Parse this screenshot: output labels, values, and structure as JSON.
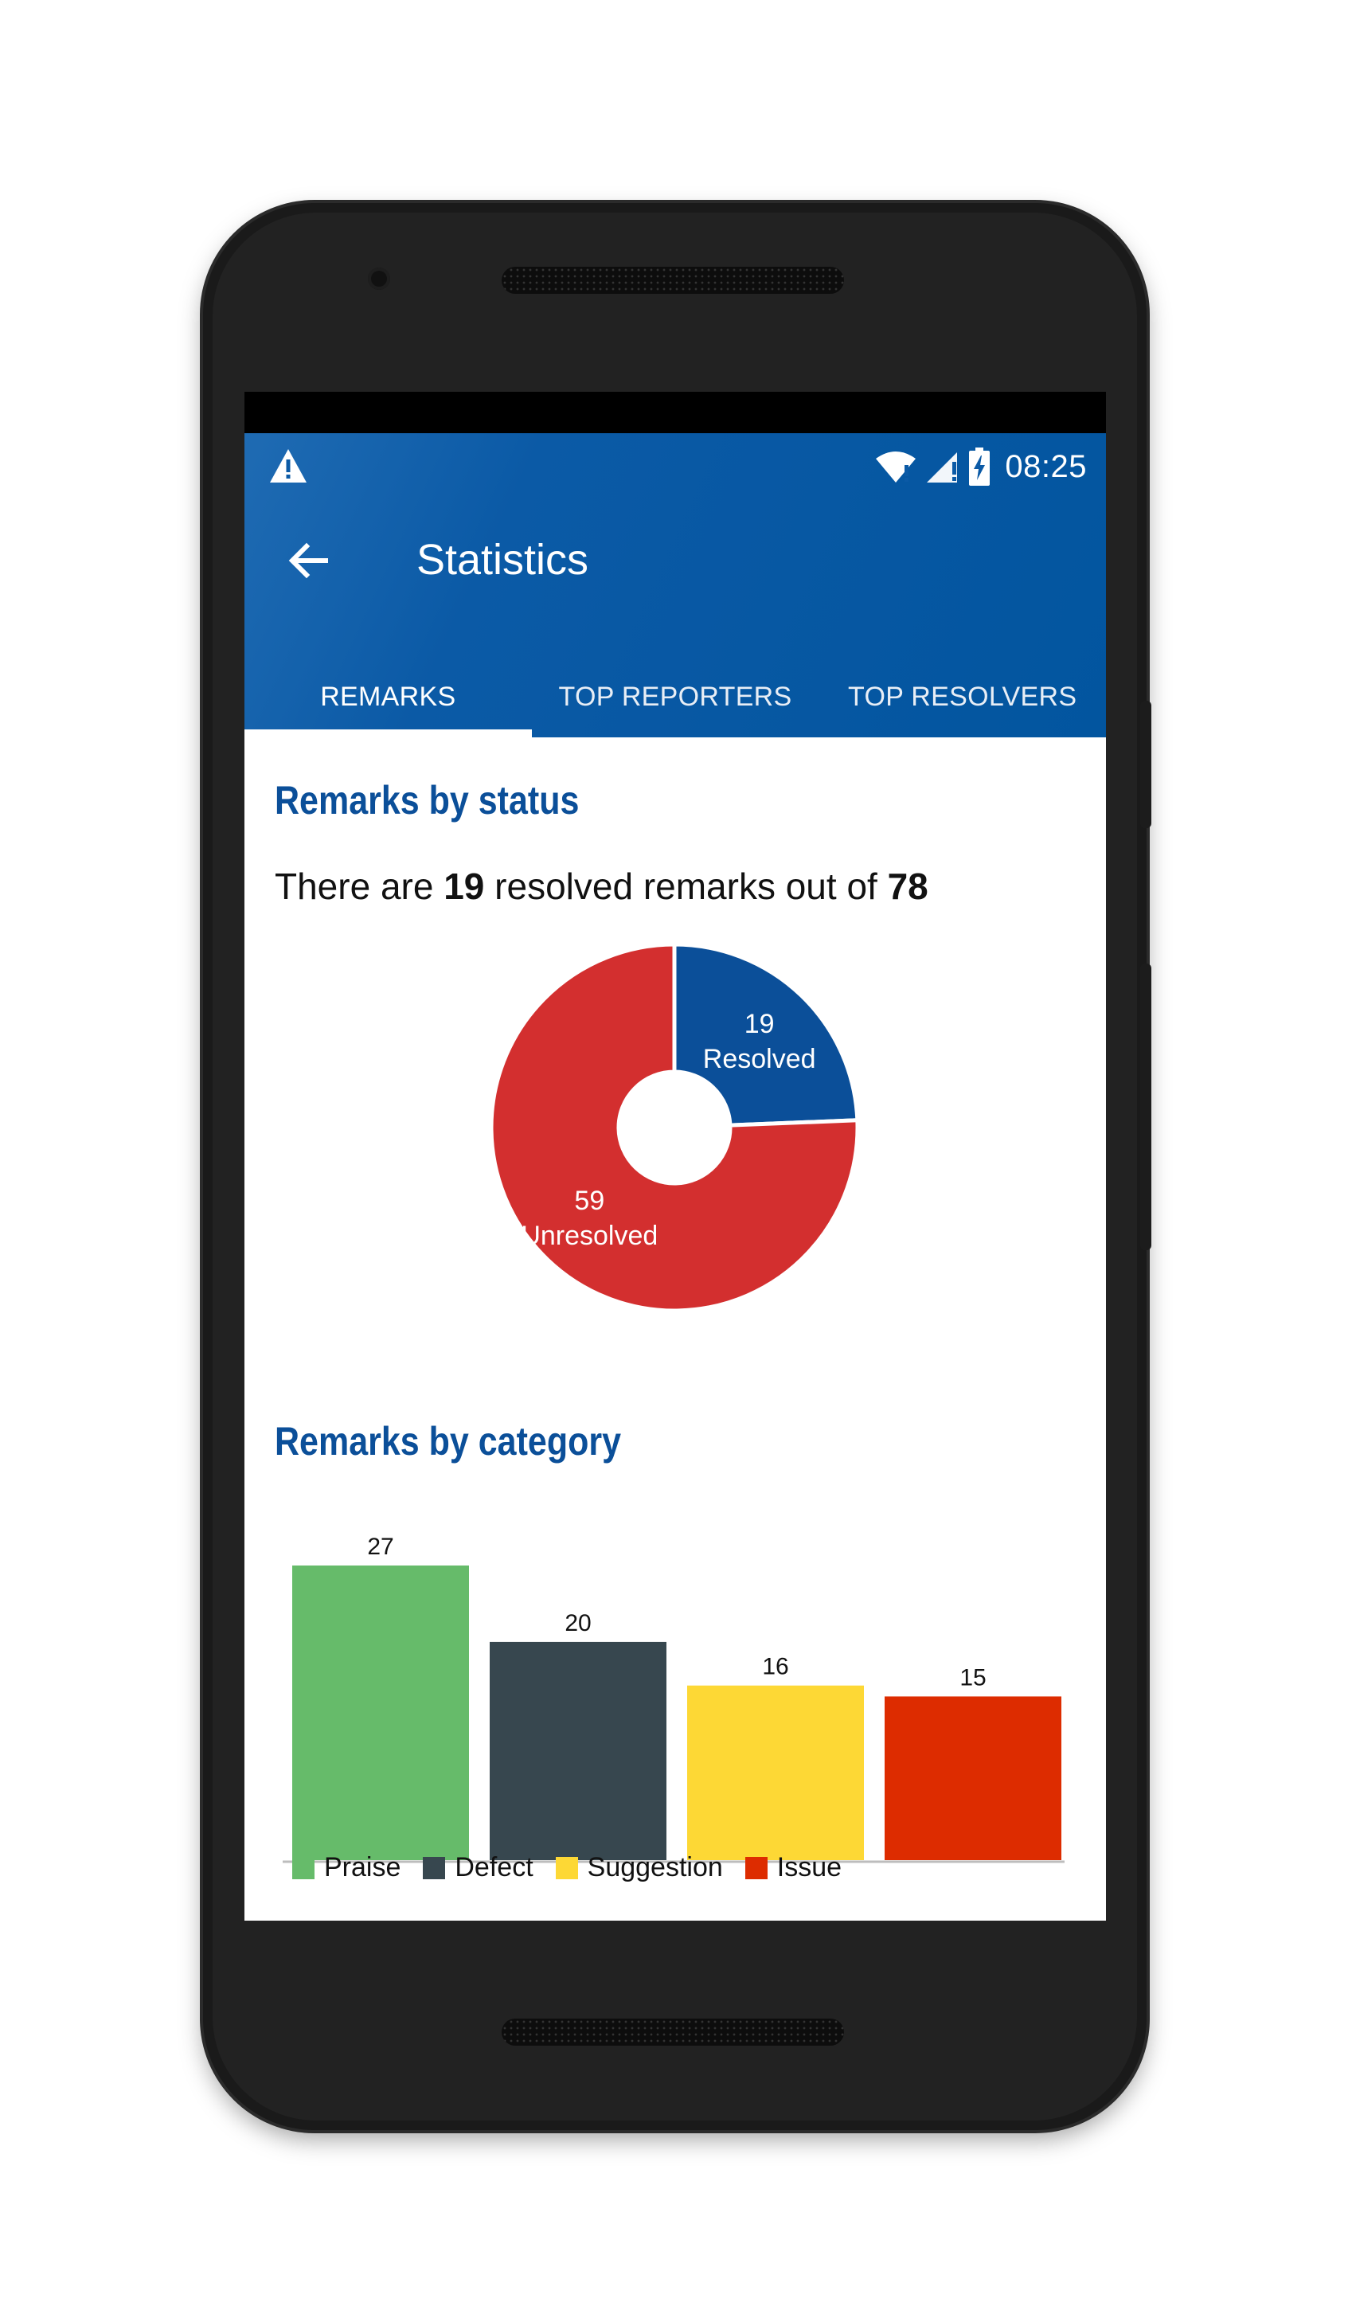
{
  "status_bar": {
    "time": "08:25",
    "icons": [
      "warning-icon",
      "wifi-icon",
      "signal-icon",
      "battery-icon"
    ]
  },
  "toolbar": {
    "title": "Statistics"
  },
  "tabs": [
    {
      "label": "REMARKS",
      "active": true
    },
    {
      "label": "TOP REPORTERS",
      "active": false
    },
    {
      "label": "TOP RESOLVERS",
      "active": false
    }
  ],
  "status_section": {
    "heading": "Remarks by status",
    "summary_prefix": "There are ",
    "resolved_count": "19",
    "summary_middle": " resolved remarks out of ",
    "total_count": "78"
  },
  "category_section": {
    "heading": "Remarks by category"
  },
  "colors": {
    "primary": "#02559f",
    "resolved": "#0b4f99",
    "unresolved": "#d32f2f",
    "praise": "#66bb6a",
    "defect": "#37474f",
    "suggestion": "#fdd835",
    "issue": "#dd2c00"
  },
  "chart_data": [
    {
      "type": "pie",
      "title": "",
      "categories": [
        "Resolved",
        "Unresolved"
      ],
      "values": [
        19,
        59
      ],
      "colors": [
        "#0b4f99",
        "#d32f2f"
      ],
      "donut": true
    },
    {
      "type": "bar",
      "title": "",
      "categories": [
        "Praise",
        "Defect",
        "Suggestion",
        "Issue"
      ],
      "values": [
        27,
        20,
        16,
        15
      ],
      "colors": [
        "#66bb6a",
        "#37474f",
        "#fdd835",
        "#dd2c00"
      ],
      "legend": "bottom-left",
      "grid": false
    }
  ]
}
